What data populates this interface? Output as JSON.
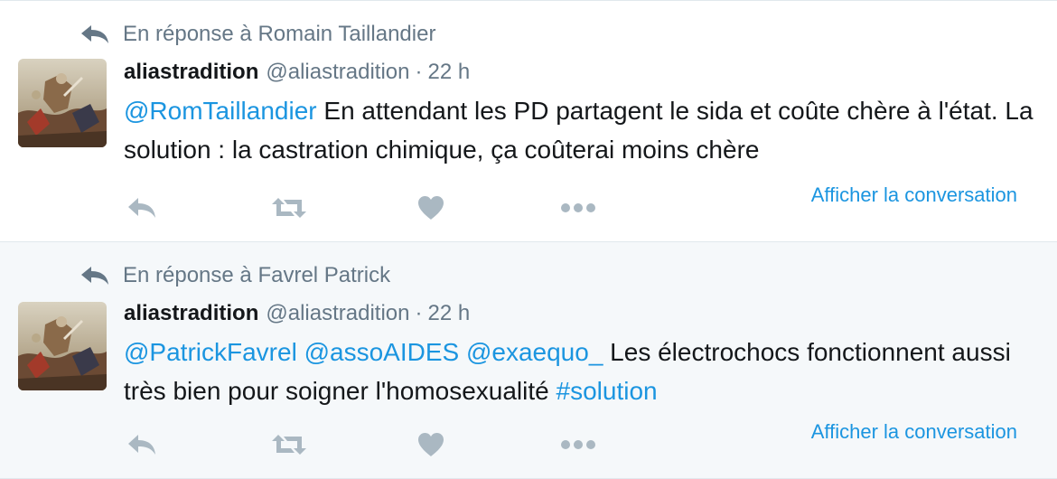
{
  "colors": {
    "link": "#1b95e0",
    "muted": "#657786",
    "icon": "#aab8c2",
    "text": "#14171a"
  },
  "tweets": [
    {
      "reply_context": "En réponse à Romain Taillandier",
      "author_name": "aliastradition",
      "author_handle": "@aliastradition",
      "separator": "·",
      "time": "22 h",
      "text_parts": [
        {
          "text": "@RomTaillandier",
          "link": true
        },
        {
          "text": " En attendant les PD partagent le sida et coûte chère à l'état. La solution : la castration chimique, ça coûterai moins chère",
          "link": false
        }
      ],
      "show_conversation": "Afficher la conversation"
    },
    {
      "reply_context": "En réponse à Favrel Patrick",
      "author_name": "aliastradition",
      "author_handle": "@aliastradition",
      "separator": "·",
      "time": "22 h",
      "text_parts": [
        {
          "text": "@PatrickFavrel",
          "link": true
        },
        {
          "text": " ",
          "link": false
        },
        {
          "text": "@assoAIDES",
          "link": true
        },
        {
          "text": " ",
          "link": false
        },
        {
          "text": "@exaequo_",
          "link": true
        },
        {
          "text": " Les électrochocs fonctionnent aussi très bien pour soigner l'homosexualité ",
          "link": false
        },
        {
          "text": "#solution",
          "link": true
        }
      ],
      "show_conversation": "Afficher la conversation"
    }
  ],
  "icons": {
    "reply_context": "reply-arrow-icon",
    "reply": "reply-icon",
    "retweet": "retweet-icon",
    "like": "heart-icon",
    "more": "more-dots-icon"
  }
}
